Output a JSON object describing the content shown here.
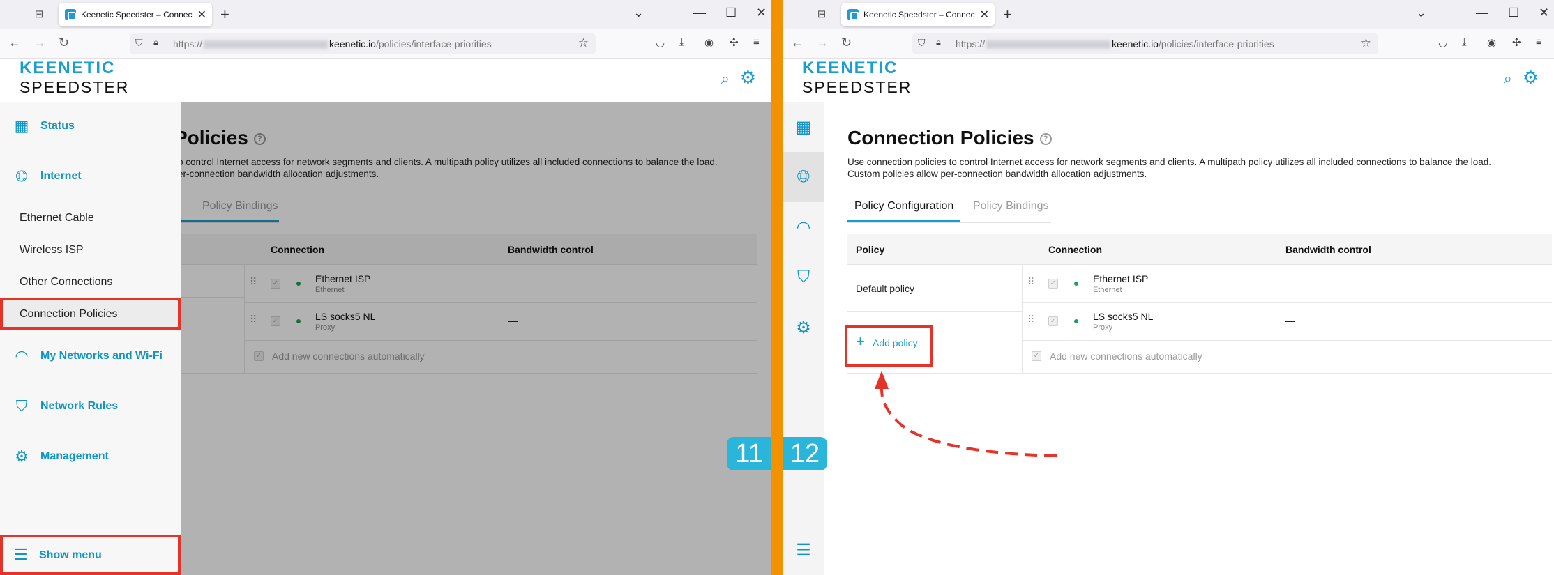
{
  "browser": {
    "tab_title": "Keenetic Speedster – Connectic",
    "url_prefix": "https://",
    "url_host": "keenetic.io",
    "url_path": "/policies/interface-priorities"
  },
  "header": {
    "logo_line1": "KEENETIC",
    "logo_line2": "SPEEDSTER"
  },
  "menu": {
    "status": "Status",
    "internet": "Internet",
    "internet_items": [
      "Ethernet Cable",
      "Wireless ISP",
      "Other Connections",
      "Connection Policies"
    ],
    "networks": "My Networks and Wi-Fi",
    "rules": "Network Rules",
    "management": "Management",
    "show_menu": "Show menu"
  },
  "left_partial": {
    "title": "Policies",
    "desc_line1": "o control Internet access for network segments and clients. A multipath policy utilizes all included connections to balance the load.",
    "desc_line2": "er-connection bandwidth allocation adjustments.",
    "tab_bindings": "Policy Bindings"
  },
  "page": {
    "title": "Connection Policies",
    "desc_line1": "Use connection policies to control Internet access for network segments and clients. A multipath policy utilizes all included connections to balance the load.",
    "desc_line2": "Custom policies allow per-connection bandwidth allocation adjustments.",
    "tabs": [
      "Policy Configuration",
      "Policy Bindings"
    ],
    "columns": {
      "policy": "Policy",
      "connection": "Connection",
      "bandwidth": "Bandwidth control"
    },
    "policies": [
      "Default policy"
    ],
    "connections": [
      {
        "name": "Ethernet ISP",
        "type": "Ethernet",
        "bandwidth": "—"
      },
      {
        "name": "LS socks5 NL",
        "type": "Proxy",
        "bandwidth": "—"
      }
    ],
    "add_auto": "Add new connections automatically",
    "add_policy": "Add policy"
  },
  "steps": {
    "left": "11",
    "right": "12"
  },
  "colors": {
    "accent": "#17a0cf",
    "highlight": "#e5332a",
    "divider": "#f39200",
    "badge": "#2ab5da"
  }
}
